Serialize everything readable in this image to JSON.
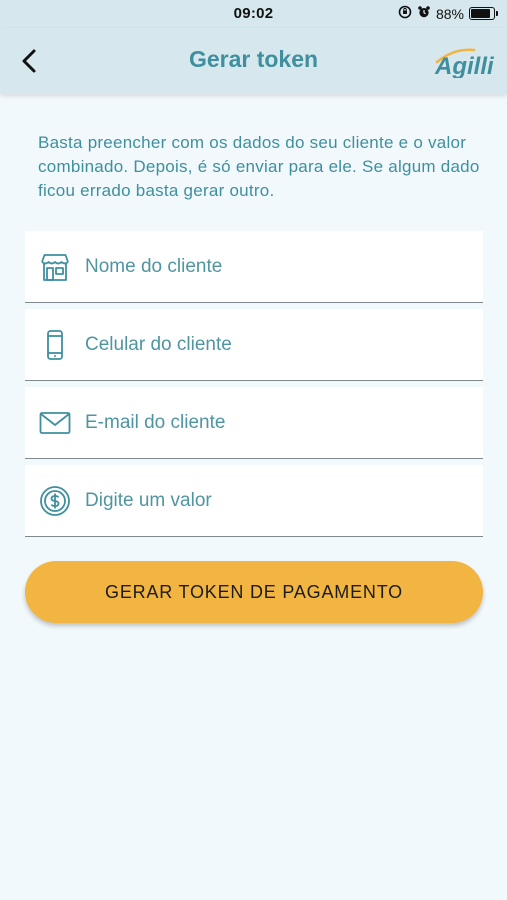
{
  "status_bar": {
    "time": "09:02",
    "battery": "88%",
    "battery_level": 0.88
  },
  "nav": {
    "title": "Gerar token",
    "brand": "Agilli",
    "back_icon": "chevron-left-icon"
  },
  "intro": {
    "text": "Basta preencher com os dados do seu cliente e o valor combinado. Depois, é só enviar para ele. Se algum dado ficou errado basta gerar outro."
  },
  "form": {
    "fields": [
      {
        "icon": "storefront-icon",
        "placeholder": "Nome do cliente",
        "value": ""
      },
      {
        "icon": "smartphone-icon",
        "placeholder": "Celular do cliente",
        "value": ""
      },
      {
        "icon": "mail-icon",
        "placeholder": "E-mail do cliente",
        "value": ""
      },
      {
        "icon": "dollar-circle-icon",
        "placeholder": "Digite um valor",
        "value": ""
      }
    ]
  },
  "actions": {
    "submit_label": "GERAR TOKEN DE PAGAMENTO"
  },
  "colors": {
    "accent": "#3f8f9e",
    "button": "#f2b541",
    "header_bg": "#d6e8ed",
    "page_bg": "#f2f9fc"
  }
}
